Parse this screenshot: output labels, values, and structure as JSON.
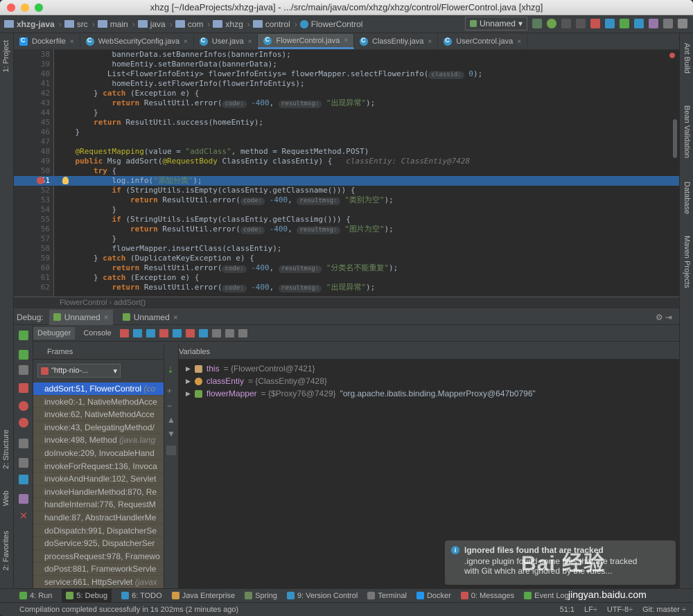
{
  "window": {
    "title": "xhzg [~/IdeaProjects/xhzg-java] - .../src/main/java/com/xhzg/xhzg/control/FlowerControl.java [xhzg]"
  },
  "navbar": {
    "crumbs": [
      "xhzg-java",
      "src",
      "main",
      "java",
      "com",
      "xhzg",
      "control",
      "FlowerControl"
    ],
    "run_config": "Unnamed"
  },
  "editor_tabs": [
    "Dockerfile",
    "WebSecurityConfig.java",
    "User.java",
    "FlowerControl.java",
    "ClassEntiy.java",
    "UserControl.java"
  ],
  "active_tab_index": 3,
  "code": {
    "lines": [
      {
        "n": "38",
        "t": "            bannerData.setBannerInfos(bannerInfos);"
      },
      {
        "n": "39",
        "t": "            homeEntiy.setBannerData(bannerData);"
      },
      {
        "n": "40",
        "t": "           List<FlowerInfoEntiy> flowerInfoEntiys= flowerMapper.selectFlowerinfo(classid: 0);"
      },
      {
        "n": "41",
        "t": "            homeEntiy.setFlowerInfo(flowerInfoEntiys);"
      },
      {
        "n": "42",
        "t": "        } catch (Exception e) {"
      },
      {
        "n": "43",
        "t": "            return ResultUtil.error(code: -400, resultmsg: \"出现异常\");"
      },
      {
        "n": "44",
        "t": "        }"
      },
      {
        "n": "45",
        "t": "        return ResultUtil.success(homeEntiy);"
      },
      {
        "n": "46",
        "t": "    }"
      },
      {
        "n": "47",
        "t": ""
      },
      {
        "n": "48",
        "t": "    @RequestMapping(value = \"addClass\", method = RequestMethod.POST)"
      },
      {
        "n": "49",
        "t": "    public Msg addSort(@RequestBody ClassEntiy classEntiy) {   classEntiy: ClassEntiy@7428"
      },
      {
        "n": "50",
        "t": "        try {"
      },
      {
        "n": "51",
        "t": "            log.info(\"添加分类\");"
      },
      {
        "n": "52",
        "t": "            if (StringUtils.isEmpty(classEntiy.getClassname())) {"
      },
      {
        "n": "53",
        "t": "                return ResultUtil.error(code: -400, resultmsg: \"类别为空\");"
      },
      {
        "n": "54",
        "t": "            }"
      },
      {
        "n": "55",
        "t": "            if (StringUtils.isEmpty(classEntiy.getClassimg())) {"
      },
      {
        "n": "56",
        "t": "                return ResultUtil.error(code: -400, resultmsg: \"图片为空\");"
      },
      {
        "n": "57",
        "t": "            }"
      },
      {
        "n": "58",
        "t": "            flowerMapper.insertClass(classEntiy);"
      },
      {
        "n": "59",
        "t": "        } catch (DuplicateKeyException e) {"
      },
      {
        "n": "60",
        "t": "            return ResultUtil.error(code: -400, resultmsg: \"分类名不能重复\");"
      },
      {
        "n": "61",
        "t": "        } catch (Exception e) {"
      },
      {
        "n": "62",
        "t": "            return ResultUtil.error(code: -400, resultmsg: \"出现异常\");"
      }
    ],
    "highlight_line": "51"
  },
  "editor_breadcrumb": {
    "cls": "FlowerControl",
    "method": "addSort()"
  },
  "debug": {
    "label": "Debug:",
    "sessions": [
      "Unnamed",
      "Unnamed"
    ],
    "subtabs": [
      "Debugger",
      "Console"
    ],
    "frames_title": "Frames",
    "variables_title": "Variables",
    "thread": "\"http-nio-...",
    "frames": [
      {
        "m": "addSort:51, FlowerControl",
        "p": "(co"
      },
      {
        "m": "invoke0:-1, NativeMethodAcce",
        "p": ""
      },
      {
        "m": "invoke:62, NativeMethodAcce",
        "p": ""
      },
      {
        "m": "invoke:43, DelegatingMethod/",
        "p": ""
      },
      {
        "m": "invoke:498, Method",
        "p": "(java.lang"
      },
      {
        "m": "doInvoke:209, InvocableHand",
        "p": ""
      },
      {
        "m": "invokeForRequest:136, Invoca",
        "p": ""
      },
      {
        "m": "invokeAndHandle:102, Servlet",
        "p": ""
      },
      {
        "m": "invokeHandlerMethod:870, Re",
        "p": ""
      },
      {
        "m": "handleInternal:776, RequestM",
        "p": ""
      },
      {
        "m": "handle:87, AbstractHandlerMe",
        "p": ""
      },
      {
        "m": "doDispatch:991, DispatcherSe",
        "p": ""
      },
      {
        "m": "doService:925, DispatcherSer",
        "p": ""
      },
      {
        "m": "processRequest:978, Framewo",
        "p": ""
      },
      {
        "m": "doPost:881, FrameworkServle",
        "p": ""
      },
      {
        "m": "service:661, HttpServlet",
        "p": "(javax"
      }
    ],
    "variables": [
      {
        "name": "this",
        "val": "= {FlowerControl@7421}",
        "extra": ""
      },
      {
        "name": "classEntiy",
        "val": "= {ClassEntiy@7428}",
        "extra": ""
      },
      {
        "name": "flowerMapper",
        "val": "= {$Proxy76@7429}",
        "extra": "\"org.apache.ibatis.binding.MapperProxy@647b0796\""
      }
    ]
  },
  "notification": {
    "title": "Ignored files found that are tracked",
    "line1": ".ignore plugin found some files that are tracked",
    "line2": "with Git which are ignored by the rules..."
  },
  "side_left": [
    "1: Project",
    "2: Structure",
    "Web",
    "2: Favorites"
  ],
  "side_right": [
    "Ant Build",
    "Bean Validation",
    "Database",
    "Maven Projects"
  ],
  "bottom_tabs": [
    "4: Run",
    "5: Debug",
    "6: TODO",
    "Java Enterprise",
    "Spring",
    "9: Version Control",
    "Terminal",
    "Docker",
    "0: Messages",
    "Event Log"
  ],
  "status": {
    "message": "Compilation completed successfully in 1s 202ms (2 minutes ago)",
    "pos": "51:1",
    "lf": "LF÷",
    "enc": "UTF-8÷",
    "git": "Git: master ÷"
  },
  "watermark": {
    "text": "Bai 经验",
    "site": "jingyan.baidu.com"
  },
  "colors": {
    "accent": "#2f65ca",
    "highlight": "#2d6099",
    "breakpoint": "#c75450"
  }
}
